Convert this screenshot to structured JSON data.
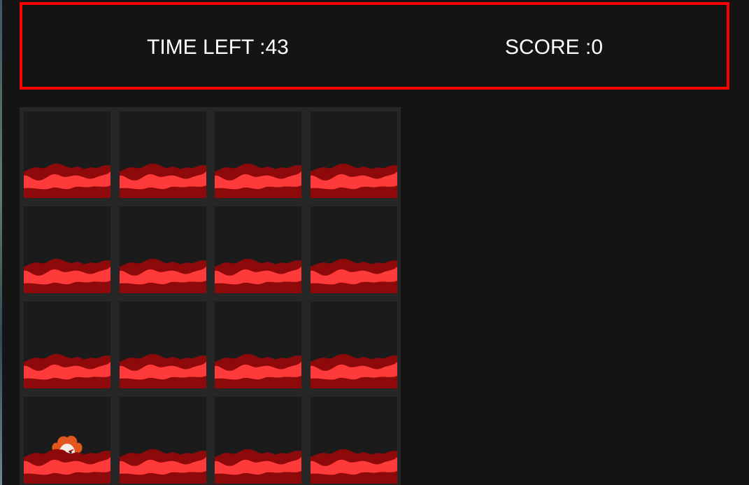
{
  "hud": {
    "time_left": "TIME LEFT :43",
    "score": "SCORE :0",
    "border_color": "#ff0000"
  },
  "board": {
    "rows": 4,
    "columns": 4,
    "holes": [
      {
        "row": 1,
        "col": 1,
        "occupant": ""
      },
      {
        "row": 1,
        "col": 2,
        "occupant": ""
      },
      {
        "row": 1,
        "col": 3,
        "occupant": ""
      },
      {
        "row": 1,
        "col": 4,
        "occupant": ""
      },
      {
        "row": 2,
        "col": 1,
        "occupant": ""
      },
      {
        "row": 2,
        "col": 2,
        "occupant": ""
      },
      {
        "row": 2,
        "col": 3,
        "occupant": ""
      },
      {
        "row": 2,
        "col": 4,
        "occupant": ""
      },
      {
        "row": 3,
        "col": 1,
        "occupant": ""
      },
      {
        "row": 3,
        "col": 2,
        "occupant": ""
      },
      {
        "row": 3,
        "col": 3,
        "occupant": ""
      },
      {
        "row": 3,
        "col": 4,
        "occupant": ""
      },
      {
        "row": 4,
        "col": 1,
        "occupant": "clown-icon"
      },
      {
        "row": 4,
        "col": 2,
        "occupant": ""
      },
      {
        "row": 4,
        "col": 3,
        "occupant": ""
      },
      {
        "row": 4,
        "col": 4,
        "occupant": ""
      }
    ],
    "colors": {
      "lava_dark": "#8e0909",
      "lava_light": "#ff3a3a",
      "hole_bg": "#1b1b1c",
      "board_bg": "#262626"
    }
  }
}
